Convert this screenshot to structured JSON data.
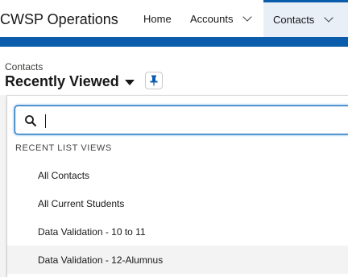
{
  "header": {
    "app_name": "CWSP Operations",
    "nav": [
      {
        "label": "Home"
      },
      {
        "label": "Accounts"
      },
      {
        "label": "Contacts"
      }
    ]
  },
  "list_header": {
    "object_label": "Contacts",
    "view_title": "Recently Viewed"
  },
  "dropdown": {
    "search_value": "",
    "section_title": "RECENT LIST VIEWS",
    "items": [
      {
        "label": "All Contacts"
      },
      {
        "label": "All Current Students"
      },
      {
        "label": "Data Validation - 10 to 11"
      },
      {
        "label": "Data Validation - 12-Alumnus"
      }
    ]
  },
  "colors": {
    "brand_bar": "#0b5cab",
    "active_tab": "#e9eff7",
    "focus_border": "#0b5cab",
    "hover_row": "#f3f3f3"
  },
  "icons": [
    "chevron-down-icon",
    "pin-icon",
    "search-icon",
    "caret-down-icon"
  ]
}
